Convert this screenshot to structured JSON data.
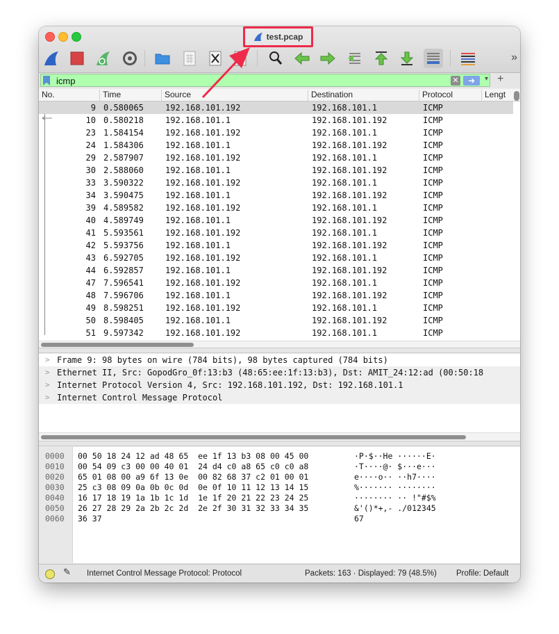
{
  "window": {
    "title": "test.pcap"
  },
  "filter": {
    "value": "icmp"
  },
  "columns": [
    "No.",
    "Time",
    "Source",
    "Destination",
    "Protocol",
    "Lengt"
  ],
  "packets": [
    {
      "no": "9",
      "time": "0.580065",
      "src": "192.168.101.192",
      "dst": "192.168.101.1",
      "proto": "ICMP"
    },
    {
      "no": "10",
      "time": "0.580218",
      "src": "192.168.101.1",
      "dst": "192.168.101.192",
      "proto": "ICMP"
    },
    {
      "no": "23",
      "time": "1.584154",
      "src": "192.168.101.192",
      "dst": "192.168.101.1",
      "proto": "ICMP"
    },
    {
      "no": "24",
      "time": "1.584306",
      "src": "192.168.101.1",
      "dst": "192.168.101.192",
      "proto": "ICMP"
    },
    {
      "no": "29",
      "time": "2.587907",
      "src": "192.168.101.192",
      "dst": "192.168.101.1",
      "proto": "ICMP"
    },
    {
      "no": "30",
      "time": "2.588060",
      "src": "192.168.101.1",
      "dst": "192.168.101.192",
      "proto": "ICMP"
    },
    {
      "no": "33",
      "time": "3.590322",
      "src": "192.168.101.192",
      "dst": "192.168.101.1",
      "proto": "ICMP"
    },
    {
      "no": "34",
      "time": "3.590475",
      "src": "192.168.101.1",
      "dst": "192.168.101.192",
      "proto": "ICMP"
    },
    {
      "no": "39",
      "time": "4.589582",
      "src": "192.168.101.192",
      "dst": "192.168.101.1",
      "proto": "ICMP"
    },
    {
      "no": "40",
      "time": "4.589749",
      "src": "192.168.101.1",
      "dst": "192.168.101.192",
      "proto": "ICMP"
    },
    {
      "no": "41",
      "time": "5.593561",
      "src": "192.168.101.192",
      "dst": "192.168.101.1",
      "proto": "ICMP"
    },
    {
      "no": "42",
      "time": "5.593756",
      "src": "192.168.101.1",
      "dst": "192.168.101.192",
      "proto": "ICMP"
    },
    {
      "no": "43",
      "time": "6.592705",
      "src": "192.168.101.192",
      "dst": "192.168.101.1",
      "proto": "ICMP"
    },
    {
      "no": "44",
      "time": "6.592857",
      "src": "192.168.101.1",
      "dst": "192.168.101.192",
      "proto": "ICMP"
    },
    {
      "no": "47",
      "time": "7.596541",
      "src": "192.168.101.192",
      "dst": "192.168.101.1",
      "proto": "ICMP"
    },
    {
      "no": "48",
      "time": "7.596706",
      "src": "192.168.101.1",
      "dst": "192.168.101.192",
      "proto": "ICMP"
    },
    {
      "no": "49",
      "time": "8.598251",
      "src": "192.168.101.192",
      "dst": "192.168.101.1",
      "proto": "ICMP"
    },
    {
      "no": "50",
      "time": "8.598405",
      "src": "192.168.101.1",
      "dst": "192.168.101.192",
      "proto": "ICMP"
    },
    {
      "no": "51",
      "time": "9.597342",
      "src": "192.168.101.192",
      "dst": "192.168.101.1",
      "proto": "ICMP"
    }
  ],
  "details": [
    "Frame 9: 98 bytes on wire (784 bits), 98 bytes captured (784 bits)",
    "Ethernet II, Src: GopodGro_0f:13:b3 (48:65:ee:1f:13:b3), Dst: AMIT_24:12:ad (00:50:18",
    "Internet Protocol Version 4, Src: 192.168.101.192, Dst: 192.168.101.1",
    "Internet Control Message Protocol"
  ],
  "bytes": [
    {
      "off": "0000",
      "hex": "00 50 18 24 12 ad 48 65  ee 1f 13 b3 08 00 45 00",
      "ascii": "·P·$··He ······E·"
    },
    {
      "off": "0010",
      "hex": "00 54 09 c3 00 00 40 01  24 d4 c0 a8 65 c0 c0 a8",
      "ascii": "·T····@· $···e···"
    },
    {
      "off": "0020",
      "hex": "65 01 08 00 a9 6f 13 0e  00 82 68 37 c2 01 00 01",
      "ascii": "e····o·· ··h7····"
    },
    {
      "off": "0030",
      "hex": "25 c3 08 09 0a 0b 0c 0d  0e 0f 10 11 12 13 14 15",
      "ascii": "%······· ········"
    },
    {
      "off": "0040",
      "hex": "16 17 18 19 1a 1b 1c 1d  1e 1f 20 21 22 23 24 25",
      "ascii": "········ ·· !\"#$%"
    },
    {
      "off": "0050",
      "hex": "26 27 28 29 2a 2b 2c 2d  2e 2f 30 31 32 33 34 35",
      "ascii": "&'()*+,- ./012345"
    },
    {
      "off": "0060",
      "hex": "36 37",
      "ascii": "67"
    }
  ],
  "status": {
    "field": "Internet Control Message Protocol: Protocol",
    "packets": "Packets: 163 · Displayed: 79 (48.5%)",
    "profile": "Profile: Default"
  },
  "colors": {
    "filter_ok": "#afffaf",
    "annotation": "#ee2b4a",
    "selected_row": "#d9d9d9"
  }
}
